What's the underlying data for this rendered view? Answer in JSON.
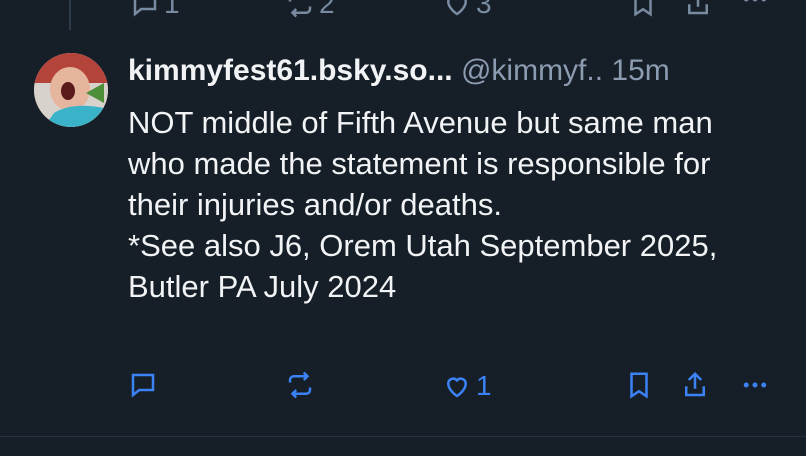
{
  "previous_post": {
    "reply_count": "1",
    "repost_count": "2",
    "like_count": "3"
  },
  "post": {
    "author_name": "kimmyfest61.bsky.so...",
    "handle": "@kimmyf..",
    "time": "15m",
    "text": "NOT middle of Fifth Avenue but same man who made the statement is responsible for their injuries and/or deaths.\n*See also J6, Orem Utah September 2025, Butler PA July 2024",
    "like_count": "1",
    "icons": {
      "reply": "reply-icon",
      "repost": "repost-icon",
      "like": "heart-icon",
      "bookmark": "bookmark-icon",
      "share": "share-icon",
      "more": "more-icon"
    }
  },
  "colors": {
    "background": "#161e27",
    "text": "#f1f3f5",
    "muted": "#788ba0",
    "accent_icons": "#3b82f6"
  }
}
